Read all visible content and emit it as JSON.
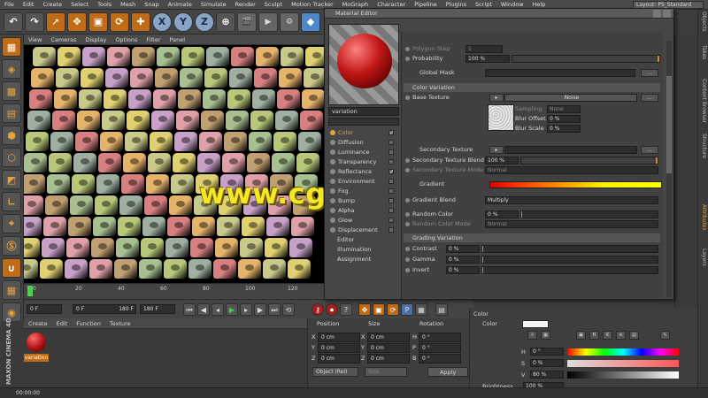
{
  "menubar": {
    "items": [
      "File",
      "Edit",
      "Create",
      "Select",
      "Tools",
      "Mesh",
      "Snap",
      "Animate",
      "Simulate",
      "Render",
      "Sculpt",
      "Motion Tracker",
      "MoGraph",
      "Character",
      "Pipeline",
      "Plugins",
      "Script",
      "Window",
      "Help"
    ],
    "layout_label": "Layout:",
    "layout_value": "PS_Standard (User)"
  },
  "toolbar": {
    "axis_x": "X",
    "axis_y": "Y",
    "axis_z": "Z"
  },
  "viewport": {
    "menu": [
      "View",
      "Cameras",
      "Display",
      "Options",
      "Filter",
      "Panel"
    ]
  },
  "watermark": "www.cgtsj.com",
  "timeline": {
    "ticks": [
      "0",
      "20",
      "40",
      "60",
      "80",
      "100",
      "120",
      "140",
      "160",
      "180"
    ],
    "start_frame": "0 F",
    "current_frame": "0 F",
    "end_frame": "180 F",
    "end_frame2": "180 F"
  },
  "material_manager": {
    "menu": [
      "Create",
      "Edit",
      "Function",
      "Texture"
    ],
    "material_name": "variation",
    "brand_top": "MAXON",
    "brand_bottom": "CINEMA 4D"
  },
  "coordinates": {
    "headers": [
      "Position",
      "Size",
      "Rotation"
    ],
    "rows": [
      {
        "axis": "X",
        "pos": "0 cm",
        "size_axis": "X",
        "size": "0 cm",
        "rot_axis": "H",
        "rot": "0 °"
      },
      {
        "axis": "Y",
        "pos": "0 cm",
        "size_axis": "Y",
        "size": "0 cm",
        "rot_axis": "P",
        "rot": "0 °"
      },
      {
        "axis": "Z",
        "pos": "0 cm",
        "size_axis": "Z",
        "size": "0 cm",
        "rot_axis": "B",
        "rot": "0 °"
      }
    ],
    "mode": "Object (Rel)",
    "size_mode": "Size",
    "apply": "Apply"
  },
  "status": "00:00:00",
  "color_panel": {
    "title": "Color",
    "color_label": "Color",
    "h_label": "H",
    "h_value": "0 °",
    "s_label": "S",
    "s_value": "0 %",
    "v_label": "V",
    "v_value": "80 %",
    "brightness_label": "Brightness",
    "brightness_value": "100 %",
    "swatch_color": "#f3f3f3"
  },
  "side_tabs": [
    "Objects",
    "Takes",
    "Content Browser",
    "Structure",
    "Attributes",
    "Layers"
  ],
  "material_editor": {
    "title": "Material Editor",
    "material_name": "variation",
    "tabs": [
      "Basic",
      "Shader"
    ],
    "channels": [
      {
        "label": "Color",
        "checked": true,
        "active": true
      },
      {
        "label": "Diffusion",
        "checked": false
      },
      {
        "label": "Luminance",
        "checked": false
      },
      {
        "label": "Transparency",
        "checked": false
      },
      {
        "label": "Reflectance",
        "checked": true
      },
      {
        "label": "Environment",
        "checked": false
      },
      {
        "label": "Fog",
        "checked": false
      },
      {
        "label": "Bump",
        "checked": false
      },
      {
        "label": "Alpha",
        "checked": false
      },
      {
        "label": "Glow",
        "checked": false
      },
      {
        "label": "Displacement",
        "checked": false
      }
    ],
    "extra": [
      "Editor",
      "Illumination",
      "Assignment"
    ],
    "props": {
      "polygon_step_label": "Polygon Step",
      "polygon_step_value": "1",
      "probability_label": "Probability",
      "probability_value": "100 %",
      "global_mask_label": "Global Mask",
      "color_variation_section": "Color Variation",
      "base_texture_label": "Base Texture",
      "base_texture_value": "Noise",
      "sampling_label": "Sampling",
      "sampling_value": "None",
      "blur_offset_label": "Blur Offset",
      "blur_offset_value": "0 %",
      "blur_scale_label": "Blur Scale",
      "blur_scale_value": "0 %",
      "secondary_texture_label": "Secondary Texture",
      "secondary_blend_label": "Secondary Texture Blend",
      "secondary_blend_value": "100 %",
      "secondary_mode_label": "Secondary Texture Mode",
      "secondary_mode_value": "Normal",
      "gradient_label": "Gradient",
      "gradient_blend_label": "Gradient Blend",
      "gradient_blend_value": "Multiply",
      "random_color_label": "Random Color",
      "random_color_value": "0 %",
      "random_mode_label": "Random Color Mode",
      "random_mode_value": "Normal",
      "grading_section": "Grading Variation",
      "contrast_label": "Contrast",
      "contrast_value": "0 %",
      "gamma_label": "Gamma",
      "gamma_value": "0 %",
      "invert_label": "Invert",
      "invert_value": "0 %",
      "ellipsis": "..."
    }
  }
}
